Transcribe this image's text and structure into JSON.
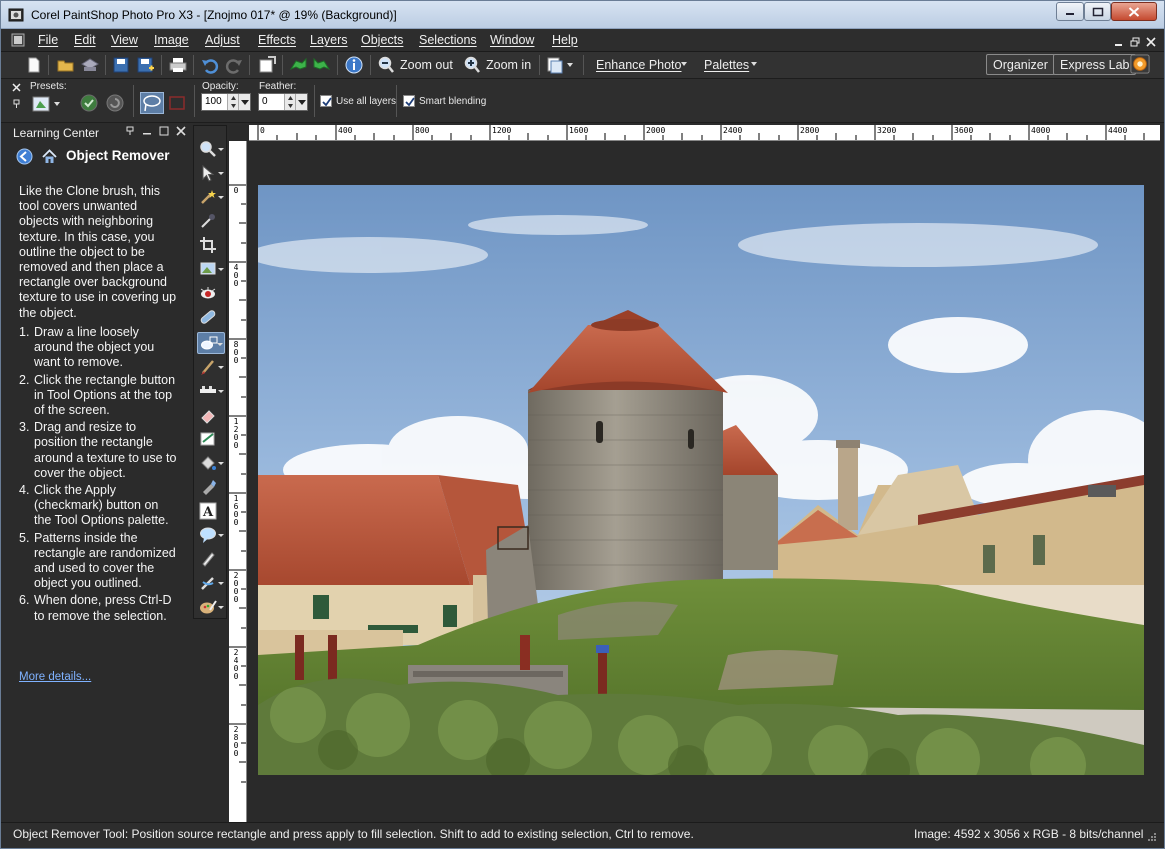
{
  "window": {
    "title": "Corel PaintShop Photo Pro X3 - [Znojmo 017* @  19% (Background)]"
  },
  "menu": {
    "items": [
      "File",
      "Edit",
      "View",
      "Image",
      "Adjust",
      "Effects",
      "Layers",
      "Objects",
      "Selections",
      "Window",
      "Help"
    ]
  },
  "toolbar": {
    "zoom_out_label": "Zoom out",
    "zoom_in_label": "Zoom in",
    "enhance_photo_label": "Enhance Photo",
    "palettes_label": "Palettes",
    "organizer_label": "Organizer",
    "express_lab_label": "Express Lab"
  },
  "tool_options": {
    "presets_label": "Presets:",
    "opacity_label": "Opacity:",
    "opacity_value": "100",
    "feather_label": "Feather:",
    "feather_value": "0",
    "use_all_layers_label": "Use all layers",
    "use_all_layers_checked": true,
    "smart_blending_label": "Smart blending",
    "smart_blending_checked": true
  },
  "learning_center": {
    "header": "Learning Center",
    "topic": "Object Remover",
    "intro": "Like the Clone brush, this tool covers unwanted objects with neighboring texture. In this case, you outline the object to be removed and then place a rectangle over background texture to use in covering up the object.",
    "steps": [
      {
        "num": "1.",
        "text": "Draw a line loosely around the object you want to remove."
      },
      {
        "num": "2.",
        "text": "Click the rectangle button in Tool Options at the top of the screen."
      },
      {
        "num": "3.",
        "text": "Drag and resize to position the rectangle around a texture to use to cover the object."
      },
      {
        "num": "4.",
        "text": "Click the Apply (checkmark) button on the Tool Options palette."
      },
      {
        "num": "5.",
        "text": "Patterns inside the rectangle are randomized and used to cover the object you outlined."
      },
      {
        "num": "6.",
        "text": "When done, press Ctrl-D to remove the selection."
      }
    ],
    "more_link": "More details..."
  },
  "ruler": {
    "h_labels": [
      "0",
      "400",
      "800",
      "1200",
      "1600",
      "2000",
      "2400",
      "2800",
      "3200",
      "3600",
      "4000",
      "4400"
    ],
    "v_labels": [
      "0",
      "400",
      "800",
      "1200",
      "1600",
      "2000",
      "2400",
      "2800"
    ]
  },
  "status": {
    "message": "Object Remover Tool: Position source rectangle and press apply to fill selection. Shift to add to existing selection, Ctrl to remove.",
    "image_info": "Image:  4592 x 3056 x RGB - 8 bits/channel"
  },
  "colors": {
    "accent": "#5d7ea6",
    "link": "#7fb2ff",
    "roof": "#b8533a"
  }
}
